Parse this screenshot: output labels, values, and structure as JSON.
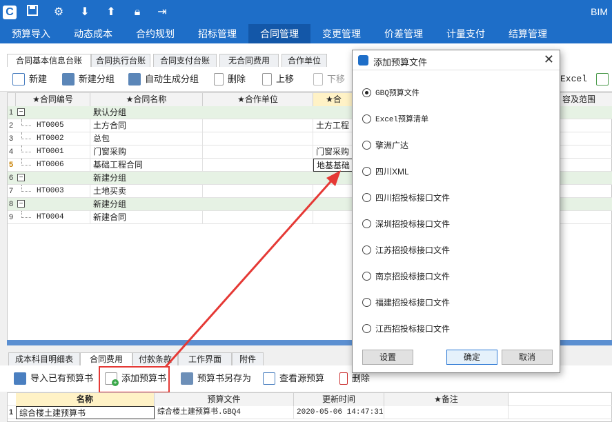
{
  "app": {
    "quick_icons": [
      "app-logo-icon",
      "save-icon",
      "gear-icon",
      "download-icon",
      "upload-icon",
      "lock-icon",
      "exit-icon"
    ],
    "brand": "BIM"
  },
  "menu": {
    "tabs": [
      "预算导入",
      "动态成本",
      "合约规划",
      "招标管理",
      "合同管理",
      "变更管理",
      "价差管理",
      "计量支付",
      "结算管理"
    ],
    "active": "合同管理"
  },
  "subtabs": [
    "合同基本信息台账",
    "合同执行台账",
    "合同支付台账",
    "无合同费用",
    "合作单位"
  ],
  "toolbar": {
    "new": "新建",
    "new_group": "新建分组",
    "auto_group": "自动生成分组",
    "delete": "删除",
    "move_up": "上移",
    "move_down": "下移",
    "excel": "Excel"
  },
  "grid": {
    "headers": [
      "★合同编号",
      "★合同名称",
      "★合作单位",
      "★合",
      "容及范围"
    ],
    "rows": [
      {
        "n": "1",
        "group": true,
        "code": "",
        "name": "默认分组",
        "unit": "",
        "col4": ""
      },
      {
        "n": "2",
        "group": false,
        "code": "HT0005",
        "name": "土方合同",
        "unit": "",
        "col4": "土方工程"
      },
      {
        "n": "3",
        "group": false,
        "code": "HT0002",
        "name": "总包",
        "unit": "",
        "col4": ""
      },
      {
        "n": "4",
        "group": false,
        "code": "HT0001",
        "name": "门窗采购",
        "unit": "",
        "col4": "门窗采购"
      },
      {
        "n": "5",
        "group": false,
        "code": "HT0006",
        "name": "基础工程合同",
        "unit": "",
        "col4": "地基基础"
      },
      {
        "n": "6",
        "group": true,
        "code": "",
        "name": "新建分组",
        "unit": "",
        "col4": ""
      },
      {
        "n": "7",
        "group": false,
        "code": "HT0003",
        "name": "土地买卖",
        "unit": "",
        "col4": ""
      },
      {
        "n": "8",
        "group": true,
        "code": "",
        "name": "新建分组",
        "unit": "",
        "col4": ""
      },
      {
        "n": "9",
        "group": false,
        "code": "HT0004",
        "name": "新建合同",
        "unit": "",
        "col4": ""
      }
    ]
  },
  "bottom_tabs": [
    "成本科目明细表",
    "合同费用",
    "付款条款",
    "工作界面",
    "附件"
  ],
  "bottom_toolbar": {
    "import": "导入已有预算书",
    "add": "添加预算书",
    "save_as": "预算书另存为",
    "view_source": "查看源预算",
    "delete": "删除"
  },
  "bottom_grid": {
    "headers": [
      "名称",
      "预算文件",
      "更新时间",
      "★备注"
    ],
    "rows": [
      {
        "n": "1",
        "name": "综合楼土建预算书",
        "file": "综合楼土建预算书.GBQ4",
        "time": "2020-05-06 14:47:31",
        "note": ""
      }
    ]
  },
  "dialog": {
    "title": "添加预算文件",
    "options": [
      "GBQ预算文件",
      "Excel预算清单",
      "擎洲广达",
      "四川XML",
      "四川招投标接口文件",
      "深圳招投标接口文件",
      "江苏招投标接口文件",
      "南京招投标接口文件",
      "福建招投标接口文件",
      "江西招投标接口文件"
    ],
    "selected_index": 0,
    "buttons": {
      "settings": "设置",
      "ok": "确定",
      "cancel": "取消"
    }
  },
  "colors": {
    "accent": "#1e6ec8",
    "highlight": "#e53935",
    "group_row": "#e6f2e4"
  }
}
